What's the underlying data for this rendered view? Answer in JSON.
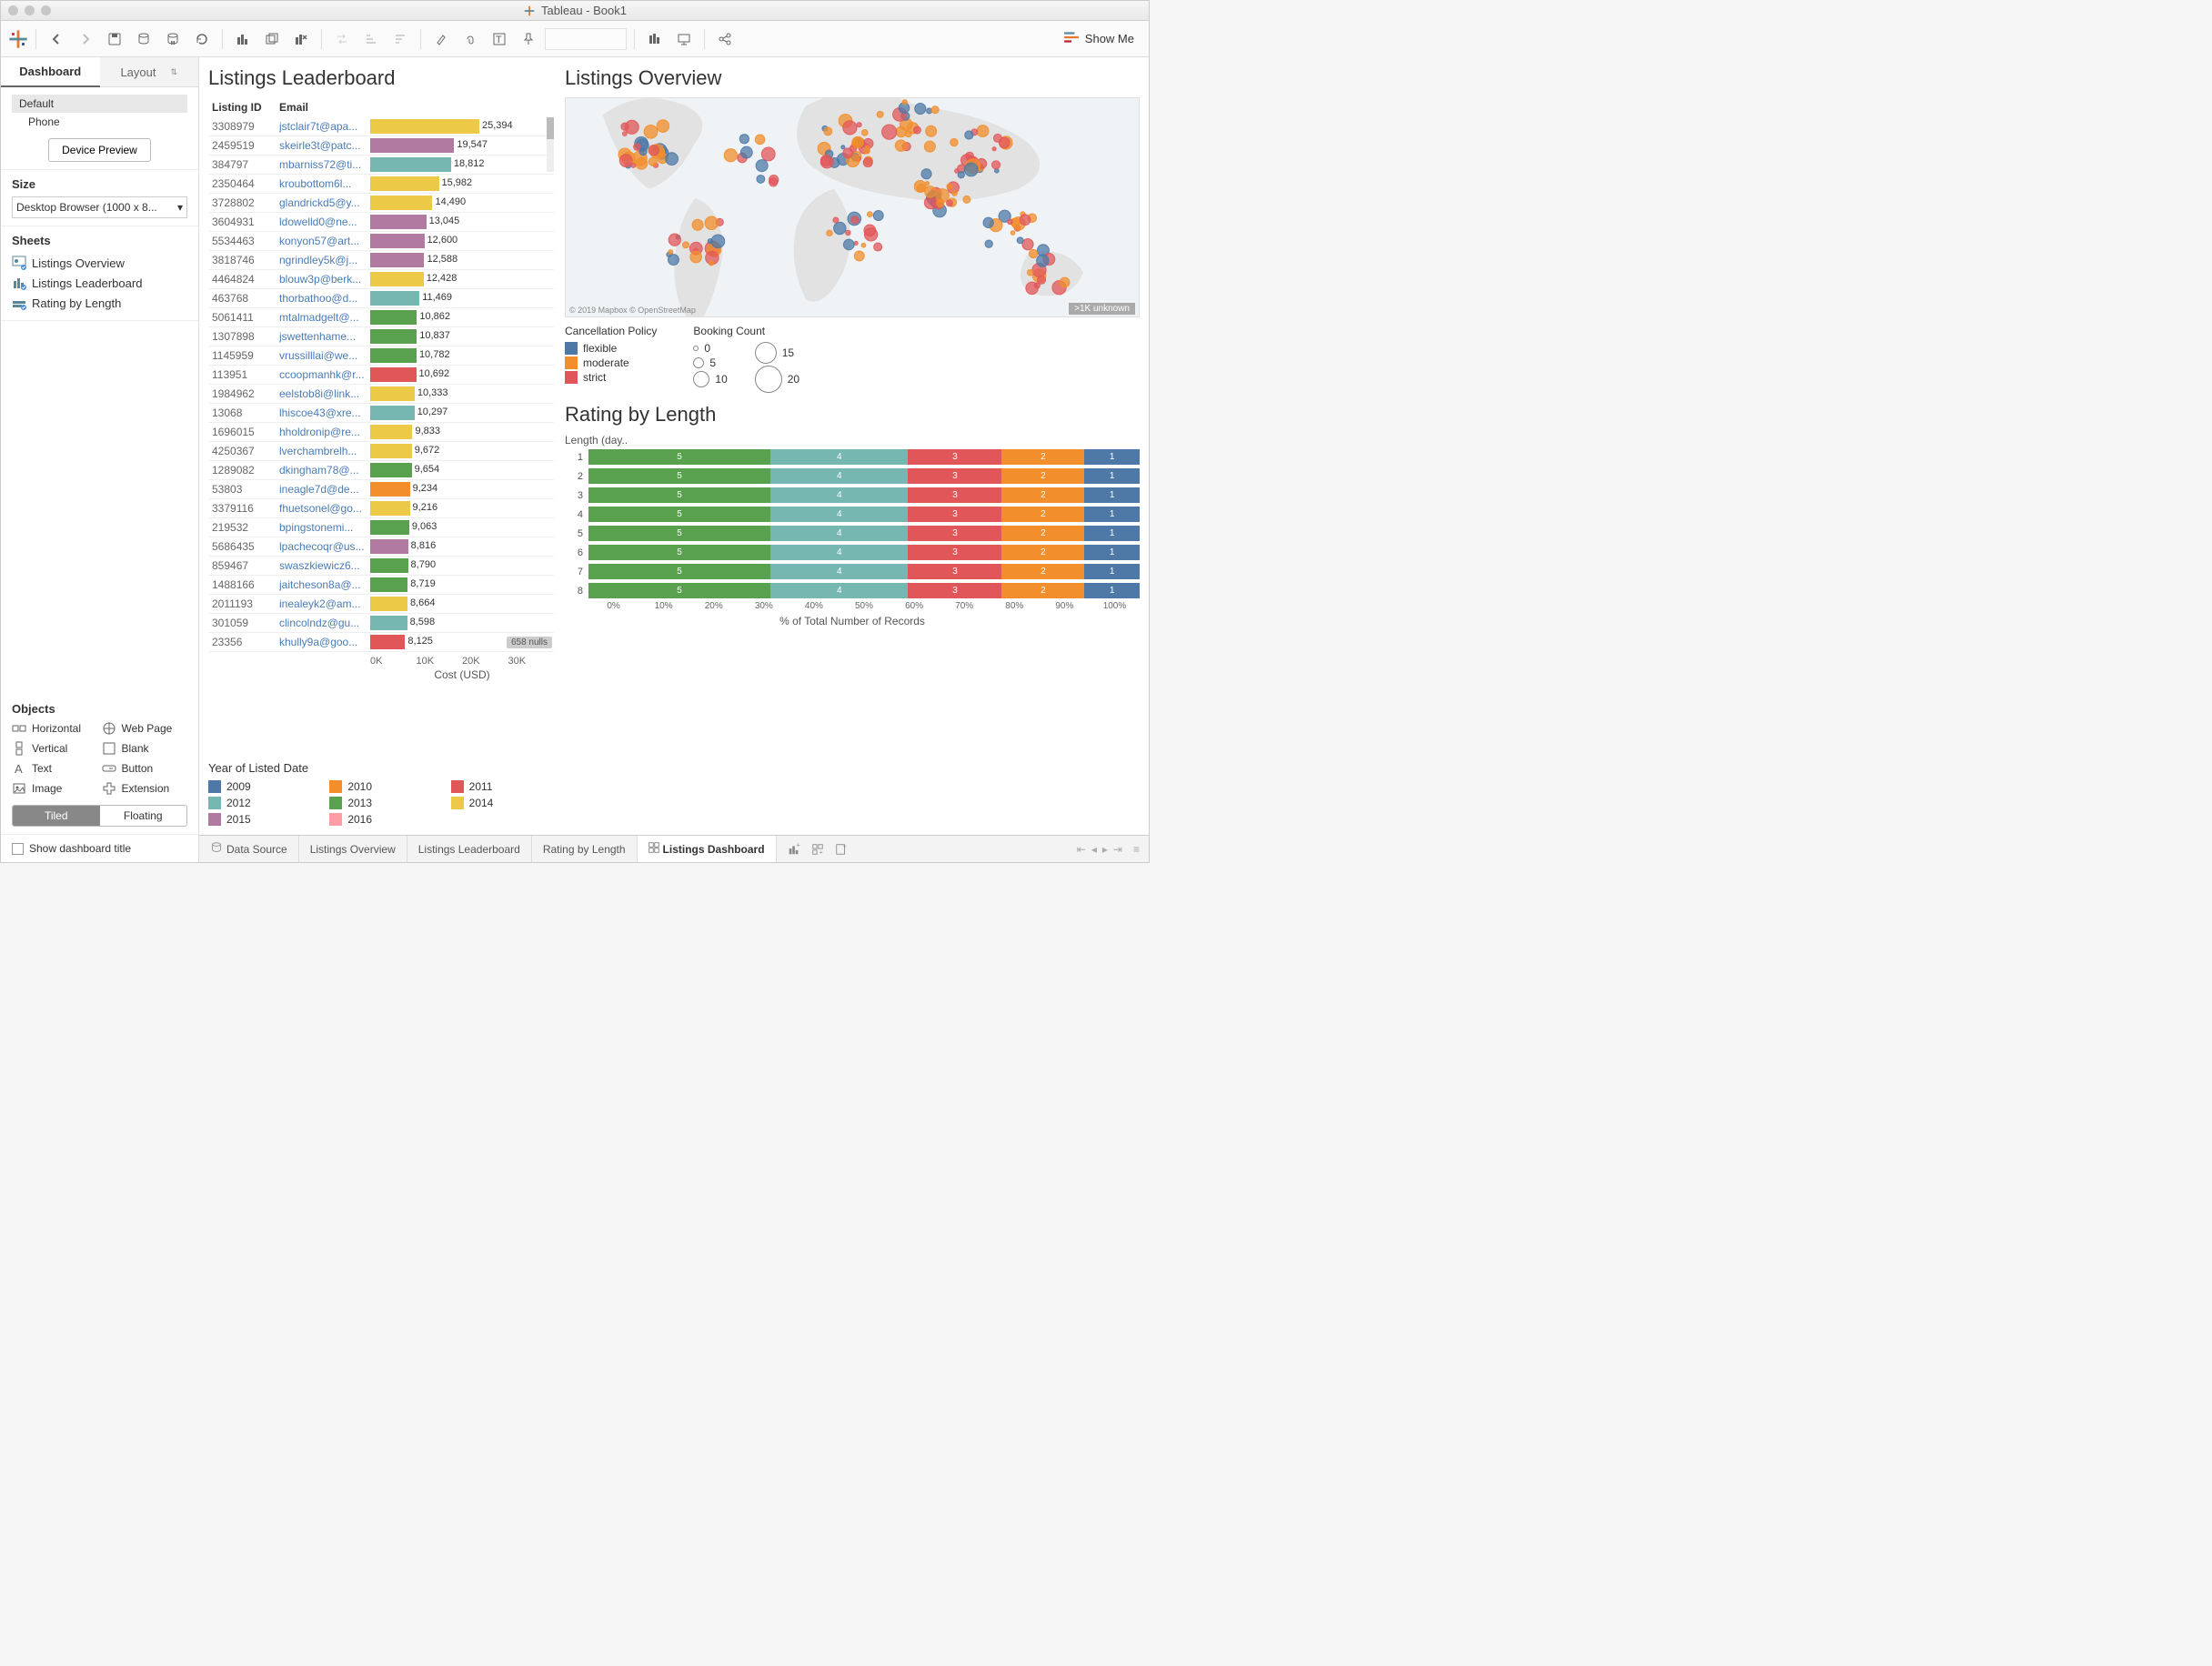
{
  "window": {
    "title": "Tableau - Book1"
  },
  "toolbar": {
    "showme": "Show Me"
  },
  "sidebar": {
    "tabs": {
      "dashboard": "Dashboard",
      "layout": "Layout"
    },
    "devices": {
      "default": "Default",
      "phone": "Phone",
      "preview_btn": "Device Preview"
    },
    "size": {
      "header": "Size",
      "value": "Desktop Browser (1000 x 8..."
    },
    "sheets": {
      "header": "Sheets",
      "items": [
        "Listings Overview",
        "Listings Leaderboard",
        "Rating by Length"
      ]
    },
    "objects": {
      "header": "Objects",
      "items": [
        {
          "label": "Horizontal"
        },
        {
          "label": "Web Page"
        },
        {
          "label": "Vertical"
        },
        {
          "label": "Blank"
        },
        {
          "label": "Text"
        },
        {
          "label": "Button"
        },
        {
          "label": "Image"
        },
        {
          "label": "Extension"
        }
      ],
      "tiled": "Tiled",
      "floating": "Floating"
    },
    "show_title": "Show dashboard title"
  },
  "leaderboard": {
    "title": "Listings Leaderboard",
    "headers": {
      "id": "Listing ID",
      "email": "Email"
    },
    "axis_label": "Cost (USD)",
    "axis_ticks": [
      "0K",
      "10K",
      "20K",
      "30K"
    ],
    "nulls": "658 nulls",
    "max": 25394
  },
  "overview": {
    "title": "Listings Overview",
    "attribution": "© 2019 Mapbox © OpenStreetMap",
    "unknown": ">1K unknown",
    "legends": {
      "policy": {
        "title": "Cancellation Policy",
        "items": [
          "flexible",
          "moderate",
          "strict"
        ]
      },
      "booking": {
        "title": "Booking Count",
        "items": [
          "0",
          "5",
          "10",
          "15",
          "20"
        ]
      }
    }
  },
  "rating": {
    "title": "Rating by Length",
    "ylabel": "Length (day..",
    "xlabel": "% of Total Number of Records",
    "xticks": [
      "0%",
      "10%",
      "20%",
      "30%",
      "40%",
      "50%",
      "60%",
      "70%",
      "80%",
      "90%",
      "100%"
    ]
  },
  "year_legend": {
    "title": "Year of Listed Date",
    "items": [
      {
        "year": "2009",
        "color": "#4e79a7"
      },
      {
        "year": "2010",
        "color": "#f28e2b"
      },
      {
        "year": "2011",
        "color": "#e15759"
      },
      {
        "year": "2012",
        "color": "#76b7b2"
      },
      {
        "year": "2013",
        "color": "#59a14f"
      },
      {
        "year": "2014",
        "color": "#edc948"
      },
      {
        "year": "2015",
        "color": "#b07aa1"
      },
      {
        "year": "2016",
        "color": "#ff9da7"
      }
    ]
  },
  "chart_data": {
    "leaderboard": {
      "type": "bar",
      "x_field": "Cost (USD)",
      "xlim": [
        0,
        30000
      ],
      "rows": [
        {
          "id": "3308979",
          "email": "jstclair7t@apa...",
          "value": 25394,
          "color": "#edc948"
        },
        {
          "id": "2459519",
          "email": "skeirle3t@patc...",
          "value": 19547,
          "color": "#b07aa1"
        },
        {
          "id": "384797",
          "email": "mbarniss72@ti...",
          "value": 18812,
          "color": "#76b7b2"
        },
        {
          "id": "2350464",
          "email": "kroubottom6l...",
          "value": 15982,
          "color": "#edc948"
        },
        {
          "id": "3728802",
          "email": "glandrickd5@y...",
          "value": 14490,
          "color": "#edc948"
        },
        {
          "id": "3604931",
          "email": "ldowelld0@ne...",
          "value": 13045,
          "color": "#b07aa1"
        },
        {
          "id": "5534463",
          "email": "konyon57@art...",
          "value": 12600,
          "color": "#b07aa1"
        },
        {
          "id": "3818746",
          "email": "ngrindley5k@j...",
          "value": 12588,
          "color": "#b07aa1"
        },
        {
          "id": "4464824",
          "email": "blouw3p@berk...",
          "value": 12428,
          "color": "#edc948"
        },
        {
          "id": "463768",
          "email": "thorbathoo@d...",
          "value": 11469,
          "color": "#76b7b2"
        },
        {
          "id": "5061411",
          "email": "mtalmadgelt@...",
          "value": 10862,
          "color": "#59a14f"
        },
        {
          "id": "1307898",
          "email": "jswettenhame...",
          "value": 10837,
          "color": "#59a14f"
        },
        {
          "id": "1145959",
          "email": "vrussilllai@we...",
          "value": 10782,
          "color": "#59a14f"
        },
        {
          "id": "113951",
          "email": "ccoopmanhk@r...",
          "value": 10692,
          "color": "#e15759"
        },
        {
          "id": "1984962",
          "email": "eelstob8i@link...",
          "value": 10333,
          "color": "#edc948"
        },
        {
          "id": "13068",
          "email": "lhiscoe43@xre...",
          "value": 10297,
          "color": "#76b7b2"
        },
        {
          "id": "1696015",
          "email": "hholdronip@re...",
          "value": 9833,
          "color": "#edc948"
        },
        {
          "id": "4250367",
          "email": "lverchambrelh...",
          "value": 9672,
          "color": "#edc948"
        },
        {
          "id": "1289082",
          "email": "dkingham78@...",
          "value": 9654,
          "color": "#59a14f"
        },
        {
          "id": "53803",
          "email": "ineagle7d@de...",
          "value": 9234,
          "color": "#f28e2b"
        },
        {
          "id": "3379116",
          "email": "fhuetsonel@go...",
          "value": 9216,
          "color": "#edc948"
        },
        {
          "id": "219532",
          "email": "bpingstonemi...",
          "value": 9063,
          "color": "#59a14f"
        },
        {
          "id": "5686435",
          "email": "lpachecoqr@us...",
          "value": 8816,
          "color": "#b07aa1"
        },
        {
          "id": "859467",
          "email": "swaszkiewicz6...",
          "value": 8790,
          "color": "#59a14f"
        },
        {
          "id": "1488166",
          "email": "jaitcheson8a@...",
          "value": 8719,
          "color": "#59a14f"
        },
        {
          "id": "2011193",
          "email": "inealeyk2@am...",
          "value": 8664,
          "color": "#edc948"
        },
        {
          "id": "301059",
          "email": "clincolndz@gu...",
          "value": 8598,
          "color": "#76b7b2"
        },
        {
          "id": "23356",
          "email": "khully9a@goo...",
          "value": 8125,
          "color": "#e15759"
        }
      ]
    },
    "rating_by_length": {
      "type": "stacked_bar_100",
      "xlabel": "% of Total Number of Records",
      "ylabel": "Length (days)",
      "categories": [
        1,
        2,
        3,
        4,
        5,
        6,
        7,
        8
      ],
      "segments": [
        {
          "label": "5",
          "color": "#59a14f",
          "pct": 33
        },
        {
          "label": "4",
          "color": "#76b7b2",
          "pct": 25
        },
        {
          "label": "3",
          "color": "#e15759",
          "pct": 17
        },
        {
          "label": "2",
          "color": "#f28e2b",
          "pct": 15
        },
        {
          "label": "1",
          "color": "#4e79a7",
          "pct": 10
        }
      ]
    },
    "map": {
      "type": "map",
      "color_field": "Cancellation Policy",
      "color_values": {
        "flexible": "#4e79a7",
        "moderate": "#f28e2b",
        "strict": "#e15759"
      },
      "size_field": "Booking Count",
      "size_range": [
        0,
        20
      ]
    }
  },
  "bottom_tabs": {
    "data_source": "Data Source",
    "tabs": [
      "Listings Overview",
      "Listings Leaderboard",
      "Rating by Length",
      "Listings Dashboard"
    ]
  }
}
